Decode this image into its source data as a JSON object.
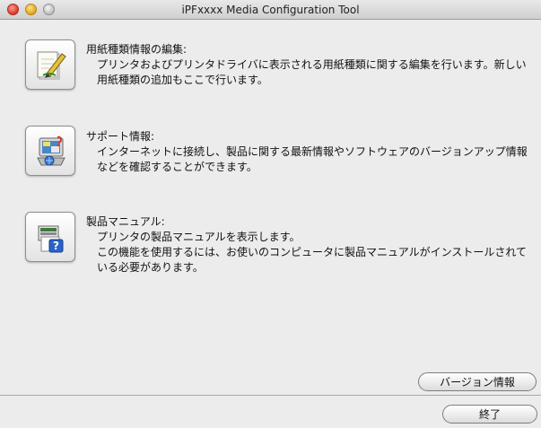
{
  "window": {
    "title": "iPFxxxx Media Configuration Tool"
  },
  "sections": [
    {
      "title": "用紙種類情報の編集:",
      "description": "プリンタおよびプリンタドライバに表示される用紙種類に関する編集を行います。新しい用紙種類の追加もここで行います。",
      "icon": "paper-edit-icon"
    },
    {
      "title": "サポート情報:",
      "description": "インターネットに接続し、製品に関する最新情報やソフトウェアのバージョンアップ情報などを確認することができます。",
      "icon": "support-info-icon"
    },
    {
      "title": "製品マニュアル:",
      "description": "プリンタの製品マニュアルを表示します。\nこの機能を使用するには、お使いのコンピュータに製品マニュアルがインストールされている必要があります。",
      "icon": "manual-help-icon"
    }
  ],
  "buttons": {
    "version": "バージョン情報",
    "quit": "終了"
  }
}
